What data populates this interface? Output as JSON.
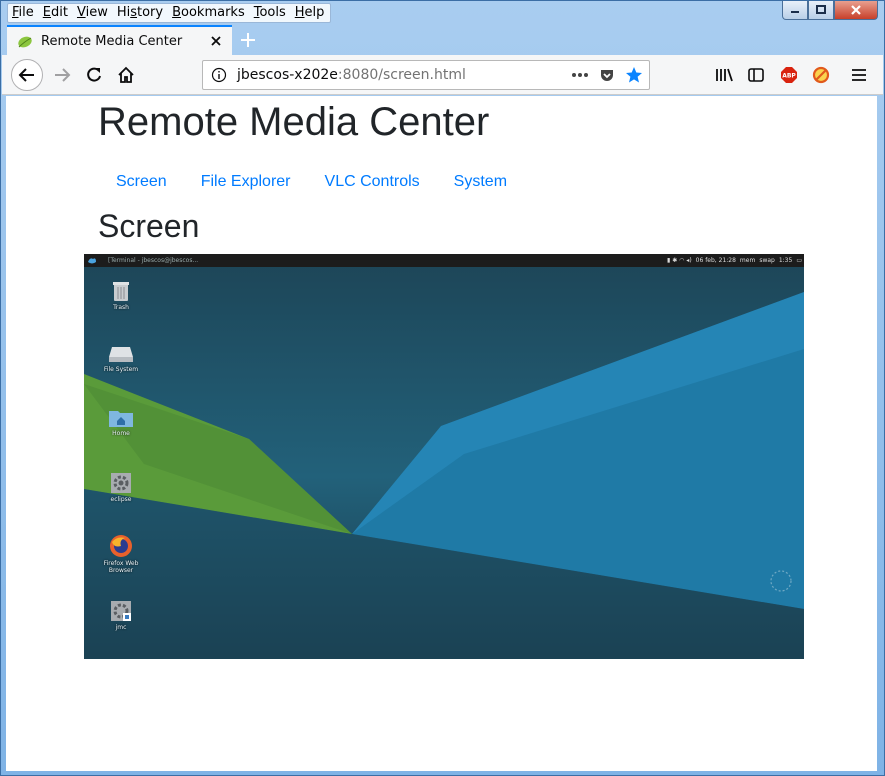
{
  "menu": [
    "File",
    "Edit",
    "View",
    "History",
    "Bookmarks",
    "Tools",
    "Help"
  ],
  "tab": {
    "title": "Remote Media Center"
  },
  "url": {
    "host": "jbescos-x202e",
    "rest": ":8080/screen.html"
  },
  "page": {
    "title": "Remote Media Center",
    "nav": [
      "Screen",
      "File Explorer",
      "VLC Controls",
      "System"
    ],
    "section_title": "Screen"
  },
  "remote_desktop": {
    "taskbar_item": "[Terminal - jbescos@jbescos...",
    "clock": "06 feb, 21:28",
    "mem_label": "mem",
    "swap_label": "swap",
    "battery_time": "1:35",
    "icons": [
      "Trash",
      "File System",
      "Home",
      "eclipse",
      "Firefox Web Browser",
      "jmc"
    ]
  }
}
